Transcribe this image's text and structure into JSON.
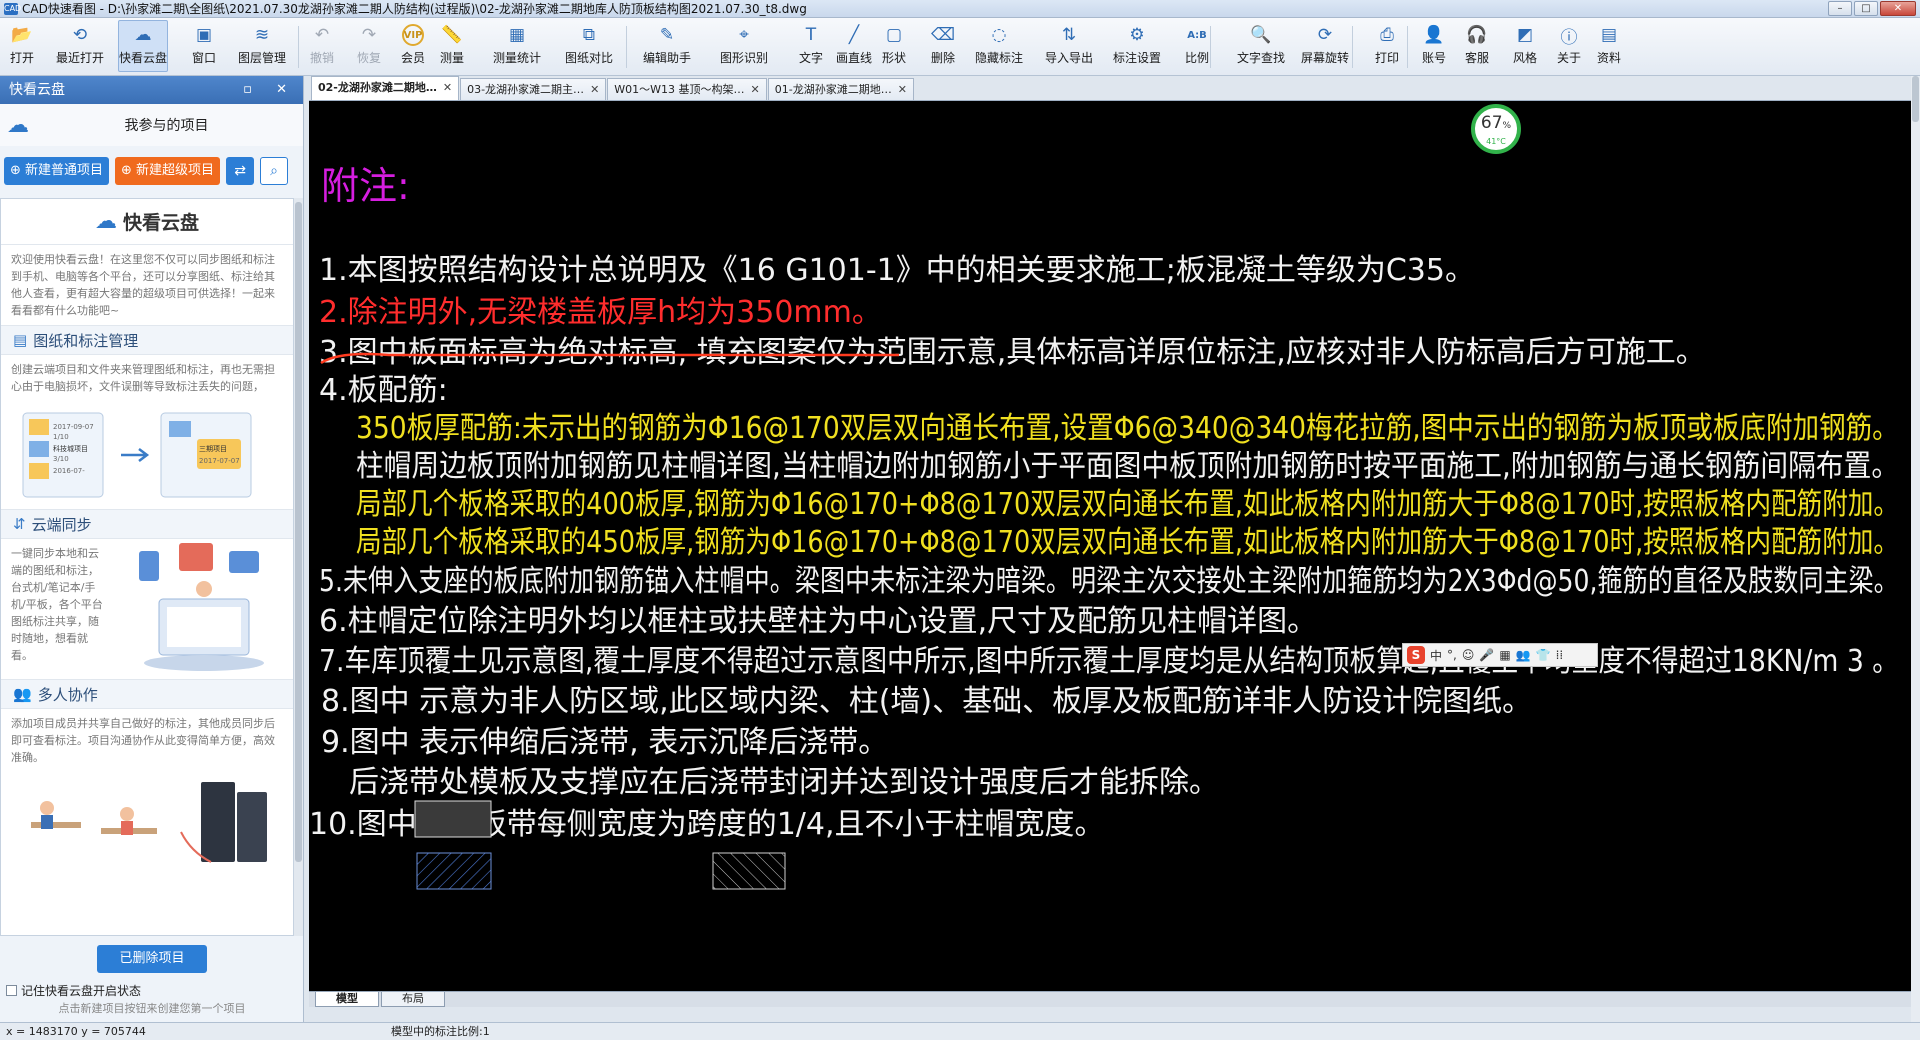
{
  "window": {
    "title": "CAD快速看图 - D:\\孙家滩二期\\全图纸\\2021.07.30龙湖孙家滩二期人防结构(过程版)\\02-龙湖孙家滩二期地库人防顶板结构图2021.07.30_t8.dwg",
    "app_icon": "CAD",
    "min": "–",
    "max": "□",
    "close": "✕"
  },
  "toolbar": [
    {
      "label": "打开",
      "icon": "folder-icon",
      "glyph": "📂"
    },
    {
      "label": "最近打开",
      "icon": "history-icon",
      "glyph": "⟲"
    },
    {
      "label": "快看云盘",
      "icon": "cloud-icon",
      "glyph": "☁"
    },
    {
      "label": "窗口",
      "icon": "window-icon",
      "glyph": "▣"
    },
    {
      "label": "图层管理",
      "icon": "layers-icon",
      "glyph": "≋"
    },
    {
      "label": "撤销",
      "icon": "undo-icon",
      "glyph": "↶"
    },
    {
      "label": "恢复",
      "icon": "redo-icon",
      "glyph": "↷"
    },
    {
      "label": "会员",
      "icon": "vip-icon",
      "glyph": "VIP"
    },
    {
      "label": "测量",
      "icon": "ruler-icon",
      "glyph": "📏"
    },
    {
      "label": "测量统计",
      "icon": "measure-stats-icon",
      "glyph": "▦"
    },
    {
      "label": "图纸对比",
      "icon": "compare-icon",
      "glyph": "⧉"
    },
    {
      "label": "编辑助手",
      "icon": "edit-helper-icon",
      "glyph": "✎"
    },
    {
      "label": "图形识别",
      "icon": "shape-recognize-icon",
      "glyph": "⌖"
    },
    {
      "label": "文字",
      "icon": "text-icon",
      "glyph": "T"
    },
    {
      "label": "画直线",
      "icon": "line-icon",
      "glyph": "╱"
    },
    {
      "label": "形状",
      "icon": "shape-icon",
      "glyph": "▢"
    },
    {
      "label": "删除",
      "icon": "eraser-icon",
      "glyph": "⌫"
    },
    {
      "label": "隐藏标注",
      "icon": "hide-icon",
      "glyph": "◌"
    },
    {
      "label": "导入导出",
      "icon": "import-export-icon",
      "glyph": "⇅"
    },
    {
      "label": "标注设置",
      "icon": "annotation-settings-icon",
      "glyph": "⚙"
    },
    {
      "label": "比例",
      "icon": "scale-icon",
      "glyph": "A:B"
    },
    {
      "label": "文字查找",
      "icon": "text-search-icon",
      "glyph": "🔍"
    },
    {
      "label": "屏幕旋转",
      "icon": "rotate-icon",
      "glyph": "⟳"
    },
    {
      "label": "打印",
      "icon": "print-icon",
      "glyph": "⎙"
    },
    {
      "label": "账号",
      "icon": "account-icon",
      "glyph": "👤"
    },
    {
      "label": "客服",
      "icon": "service-icon",
      "glyph": "🎧"
    },
    {
      "label": "风格",
      "icon": "style-icon",
      "glyph": "◩"
    },
    {
      "label": "关于",
      "icon": "info-icon",
      "glyph": "ⓘ"
    },
    {
      "label": "资料",
      "icon": "docs-icon",
      "glyph": "▤"
    }
  ],
  "sidebar": {
    "title": "快看云盘",
    "header_buttons": "▫ ✕",
    "project_heading": "我参与的项目",
    "new_normal": "⊕ 新建普通项目",
    "new_super": "⊕ 新建超级项目",
    "cloud_name": "快看云盘",
    "intro": "欢迎使用快看云盘！在这里您不仅可以同步图纸和标注到手机、电脑等各个平台，还可以分享图纸、标注给其他人查看，更有超大容量的超级项目可供选择！一起来看看都有什么功能吧~",
    "sec1_title": "图纸和标注管理",
    "sec1_text": "创建云端项目和文件夹来管理图纸和标注，再也无需担心由于电脑损坏，文件误删等导致标注丢失的问题，",
    "sec1_illus": [
      "2017-09-07",
      "1/10",
      "科技城项目",
      "3/10",
      "2016-07-",
      "三期项目",
      "2017-07-07"
    ],
    "sec2_title": "云端同步",
    "sec2_text": "一键同步本地和云端的图纸和标注，台式机/笔记本/手机/平板，各个平台图纸标注共享，随时随地，想看就看。",
    "sec3_title": "多人协作",
    "sec3_text": "添加项目成员并共享自己做好的标注，其他成员同步后即可查看标注。项目沟通协作从此变得简单方便，高效准确。",
    "deleted_btn": "已删除项目",
    "remember": "记住快看云盘开启状态",
    "hint": "点击新建项目按钮来创建您第一个项目"
  },
  "tabs": [
    {
      "label": "02-龙湖孙家滩二期地…",
      "close": "✕"
    },
    {
      "label": "03-龙湖孙家滩二期主…",
      "close": "✕"
    },
    {
      "label": "W01～W13 基顶～构架…",
      "close": "✕"
    },
    {
      "label": "01-龙湖孙家滩二期地…",
      "close": "✕"
    }
  ],
  "drawing": {
    "heading": "附注:",
    "lines": [
      {
        "text": "1.本图按照结构设计总说明及《16 G101-1》中的相关要求施工;板混凝土等级为C35。",
        "color": "w"
      },
      {
        "text": "2.除注明外,无梁楼盖板厚h均为350mm。",
        "color": "r"
      },
      {
        "text": "3.图中板面标高为绝对标高,         填充图案仅为范围示意,具体标高详原位标注,应核对非人防标高后方可施工。",
        "color": "w"
      },
      {
        "text": "4.板配筋:",
        "color": "w"
      },
      {
        "text": "350板厚配筋:未示出的钢筋为Φ16@170双层双向通长布置,设置Φ6@340@340梅花拉筋,图中示出的钢筋为板顶或板底附加钢筋。",
        "color": "y"
      },
      {
        "text": "柱帽周边板顶附加钢筋见柱帽详图,当柱帽边附加钢筋小于平面图中板顶附加钢筋时按平面施工,附加钢筋与通长钢筋间隔布置。",
        "color": "w"
      },
      {
        "text": "局部几个板格采取的400板厚,钢筋为Φ16@170+Φ8@170双层双向通长布置,如此板格内附加筋大于Φ8@170时,按照板格内配筋附加。",
        "color": "y"
      },
      {
        "text": "局部几个板格采取的450板厚,钢筋为Φ16@170+Φ8@170双层双向通长布置,如此板格内附加筋大于Φ8@170时,按照板格内配筋附加。",
        "color": "y"
      },
      {
        "text": "5.未伸入支座的板底附加钢筋锚入柱帽中。梁图中未标注梁为暗梁。明梁主次交接处主梁附加箍筋均为2X3Φd@50,箍筋的直径及肢数同主梁。",
        "color": "w"
      },
      {
        "text": "6.柱帽定位除注明外均以框柱或扶壁柱为中心设置,尺寸及配筋见柱帽详图。",
        "color": "w"
      },
      {
        "text": "7.车库顶覆土见示意图,覆土厚度不得超过示意图中所示,图中所示覆土厚度均是从结构顶板算起,且覆土平均重度不得超过18KN/m 3 。",
        "color": "w"
      },
      {
        "text": "8.图中          示意为非人防区域,此区域内梁、柱(墙)、基础、板厚及板配筋详非人防设计院图纸。",
        "color": "w"
      },
      {
        "text": "9.图中          表示伸缩后浇带,            表示沉降后浇带。",
        "color": "w"
      },
      {
        "text": "后浇带处模板及支撑应在后浇带封闭并达到设计强度后才能拆除。",
        "color": "w"
      },
      {
        "text": "10.图中柱上板带每侧宽度为跨度的1/4,且不小于柱帽宽度。",
        "color": "w"
      }
    ]
  },
  "gauge": {
    "percent": "67",
    "unit": "%",
    "temp": "41°C",
    "level": 0.67
  },
  "ime": {
    "logo": "S",
    "items": [
      "中",
      "°,",
      "☺",
      "🎤",
      "▦",
      "👥",
      "👕",
      "⁞⁞"
    ]
  },
  "layout_tabs": [
    "模型",
    "布局"
  ],
  "status": {
    "coords": "x = 1483170  y = 705744",
    "scale": "模型中的标注比例:1"
  }
}
